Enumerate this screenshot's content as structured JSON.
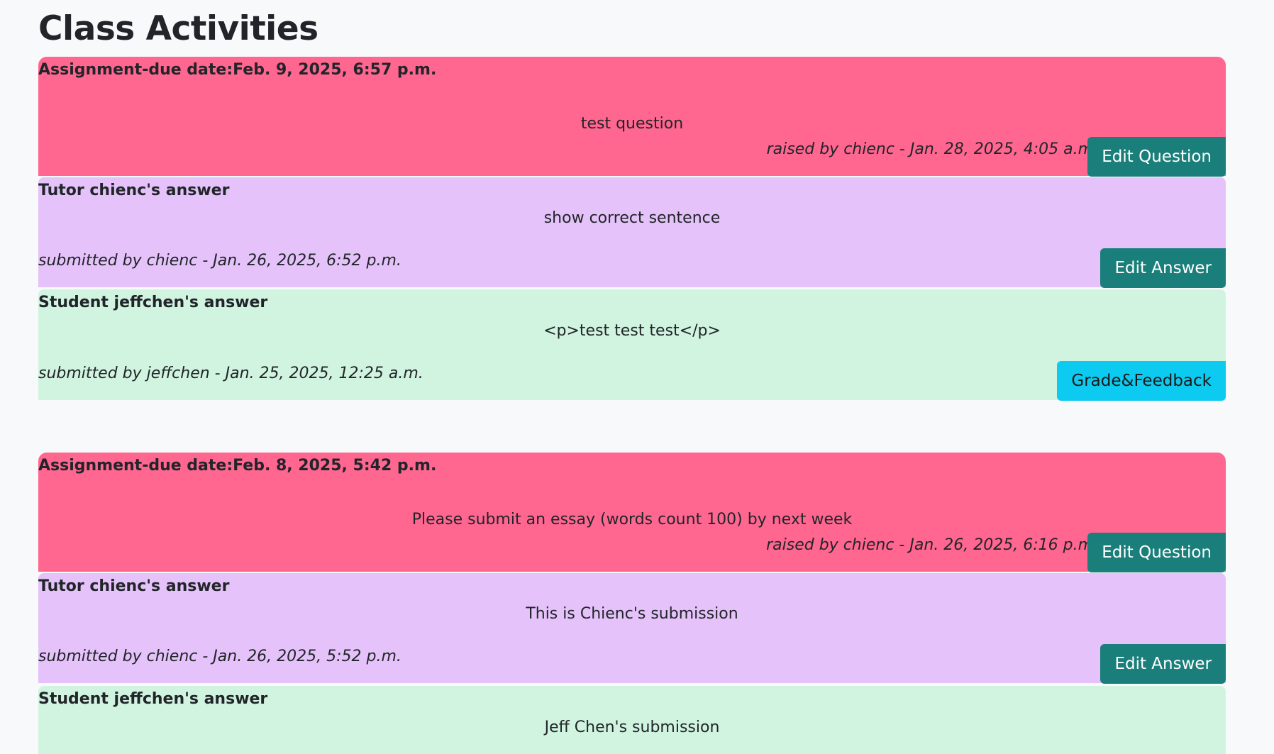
{
  "page": {
    "title": "Class Activities"
  },
  "activities": [
    {
      "question": {
        "title": "Assignment-due date:Feb. 9, 2025, 6:57 p.m.",
        "body": "test question",
        "meta": "raised by chienc - Jan. 28, 2025, 4:05 a.m.",
        "button": "Edit Question"
      },
      "tutor": {
        "title": "Tutor chienc's answer",
        "body": "show correct sentence",
        "meta": "submitted by chienc - Jan. 26, 2025, 6:52 p.m.",
        "button": "Edit Answer"
      },
      "student": {
        "title": "Student jeffchen's answer",
        "body": "<p>test test test</p>",
        "meta": "submitted by jeffchen - Jan. 25, 2025, 12:25 a.m.",
        "button": "Grade&Feedback"
      }
    },
    {
      "question": {
        "title": "Assignment-due date:Feb. 8, 2025, 5:42 p.m.",
        "body": "Please submit an essay (words count 100) by next week",
        "meta": "raised by chienc - Jan. 26, 2025, 6:16 p.m.",
        "button": "Edit Question"
      },
      "tutor": {
        "title": "Tutor chienc's answer",
        "body": "This is Chienc's submission",
        "meta": "submitted by chienc - Jan. 26, 2025, 5:52 p.m.",
        "button": "Edit Answer"
      },
      "student": {
        "title": "Student jeffchen's answer",
        "body": "Jeff Chen's submission"
      }
    }
  ],
  "colors": {
    "question_bg": "#ff6690",
    "tutor_bg": "#e5c2fa",
    "student_bg": "#d1f4e0",
    "edit_button": "#1a7f7a",
    "grade_button": "#0dcaf0"
  }
}
